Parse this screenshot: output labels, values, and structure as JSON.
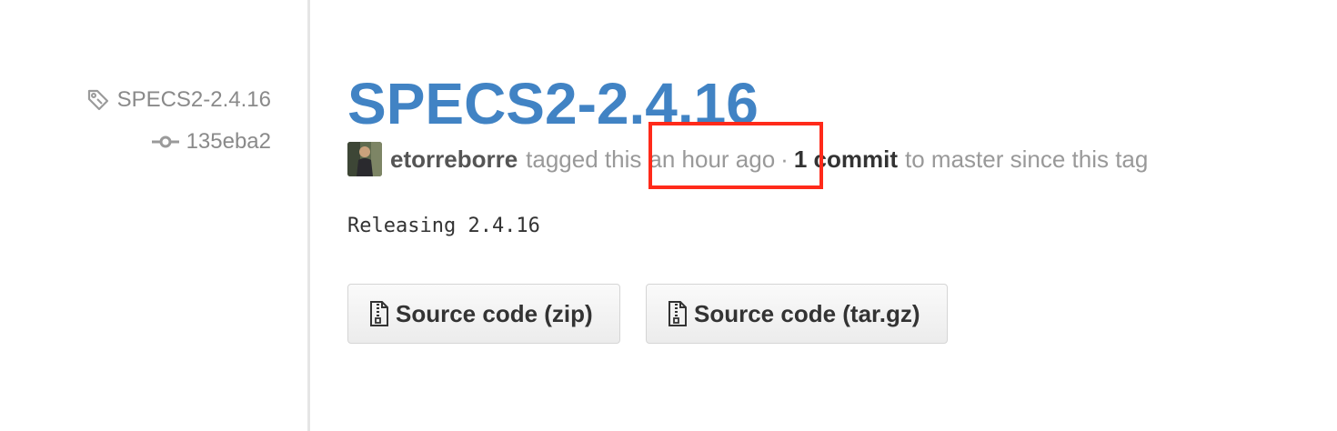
{
  "sidebar": {
    "tag": {
      "icon": "tag-icon",
      "label": "SPECS2-2.4.16"
    },
    "commit": {
      "icon": "git-commit-icon",
      "label": "135eba2"
    }
  },
  "release": {
    "title": "SPECS2-2.4.16",
    "author": "etorreborre",
    "tagged_text": "tagged this",
    "time_text": "an hour ago",
    "separator": "·",
    "commits_text": "1 commit",
    "since_text": "to master since this tag",
    "body": "Releasing 2.4.16"
  },
  "downloads": {
    "zip_label": "Source code (zip)",
    "targz_label": "Source code (tar.gz)",
    "icon": "file-zip-icon"
  },
  "colors": {
    "title_blue": "#4183c4",
    "highlight_red": "#ff2a1a",
    "muted_gray": "#999999"
  }
}
